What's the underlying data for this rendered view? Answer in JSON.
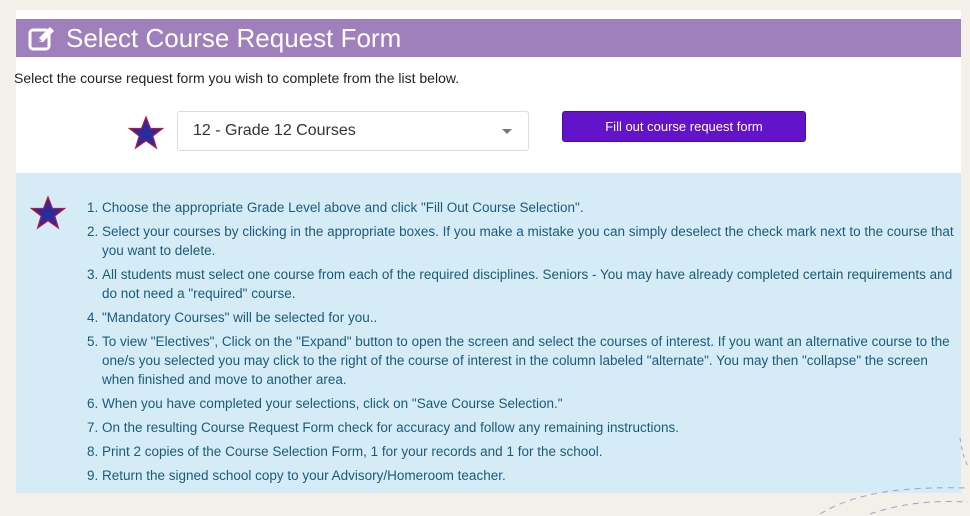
{
  "header": {
    "title": "Select Course Request Form",
    "icon": "edit-icon"
  },
  "intro_text": "Select the course request form you wish to complete from the list below.",
  "grade_select": {
    "selected": "12 - Grade 12 Courses"
  },
  "fill_button_label": "Fill out course request form",
  "colors": {
    "header_bg": "#a07fbd",
    "button_bg": "#6313c9",
    "instructions_bg": "#d5ecf6",
    "instructions_text": "#1b5b78",
    "star_fill": "#2b2b9e",
    "star_outline": "#c0143c"
  },
  "instructions": [
    "Choose the appropriate Grade Level above and click \"Fill Out Course Selection\".",
    "Select your courses by clicking in the appropriate boxes. If you make a mistake you can simply deselect the check mark next to the course that you want to delete.",
    "All students must select one course from each of the required disciplines.  Seniors - You may have already completed certain requirements and do not need a \"required\" course.",
    "\"Mandatory Courses\" will be selected for you..",
    "To view \"Electives\", Click on the \"Expand\" button to open the screen and select the courses of interest. If you want an alternative course to the one/s you selected you may click to the right of the course of interest in the column labeled \"alternate\". You may then \"collapse\" the screen when finished and move to another area.",
    "When you have completed your selections, click on \"Save Course Selection.\"",
    "On the resulting Course Request Form check for accuracy and follow any remaining instructions.",
    "Print 2 copies of the Course Selection Form, 1 for your records and 1 for the school.",
    "Return the signed school copy to your Advisory/Homeroom teacher."
  ]
}
